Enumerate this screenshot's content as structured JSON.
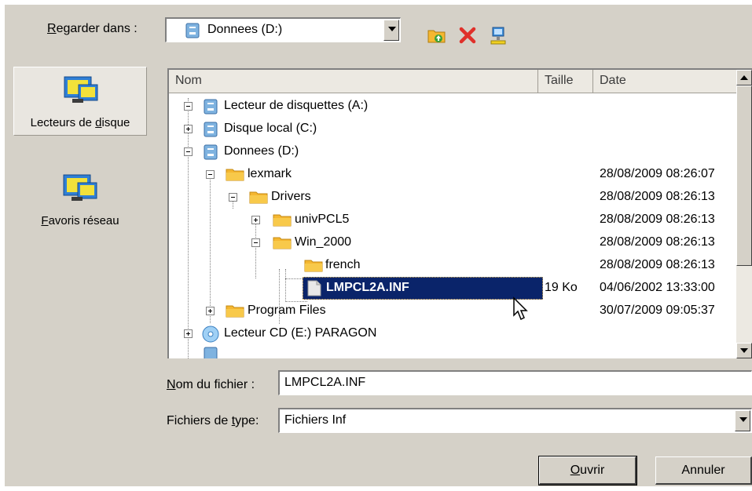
{
  "lookin": {
    "label_prefix": "",
    "label_ul": "R",
    "label_rest": "egarder dans :",
    "value": "Donnees (D:)"
  },
  "toolbar": {
    "icons": [
      "folder-up-icon",
      "delete-icon",
      "network-icon"
    ]
  },
  "places": [
    {
      "label_pre": "Lecteurs de ",
      "label_ul": "d",
      "label_post": "isque",
      "icon": "computer-icon",
      "selected": true
    },
    {
      "label_pre": "",
      "label_ul": "F",
      "label_post": "avoris réseau",
      "icon": "network-icon",
      "selected": false
    }
  ],
  "columns": {
    "name": "Nom",
    "size": "Taille",
    "date": "Date"
  },
  "tree": [
    {
      "name": "Lecteur de disquettes (A:)",
      "size": "",
      "date": "",
      "icon": "floppy-drive-icon"
    },
    {
      "name": "Disque local (C:)",
      "size": "",
      "date": "",
      "icon": "hard-drive-icon"
    },
    {
      "name": "Donnees (D:)",
      "size": "",
      "date": "",
      "icon": "hard-drive-icon"
    },
    {
      "name": "lexmark",
      "size": "",
      "date": "28/08/2009 08:26:07",
      "icon": "folder-icon"
    },
    {
      "name": "Drivers",
      "size": "",
      "date": "28/08/2009 08:26:13",
      "icon": "folder-icon"
    },
    {
      "name": "univPCL5",
      "size": "",
      "date": "28/08/2009 08:26:13",
      "icon": "folder-icon"
    },
    {
      "name": "Win_2000",
      "size": "",
      "date": "28/08/2009 08:26:13",
      "icon": "folder-icon"
    },
    {
      "name": "french",
      "size": "",
      "date": "28/08/2009 08:26:13",
      "icon": "folder-icon"
    },
    {
      "name": "LMPCL2A.INF",
      "size": "19 Ko",
      "date": "04/06/2002 13:33:00",
      "icon": "file-icon"
    },
    {
      "name": "Program Files",
      "size": "",
      "date": "30/07/2009 09:05:37",
      "icon": "folder-icon"
    },
    {
      "name": "Lecteur CD (E:) PARAGON",
      "size": "",
      "date": "",
      "icon": "cd-drive-icon"
    }
  ],
  "filename": {
    "label_ul": "N",
    "label_rest": "om du fichier :",
    "value": "LMPCL2A.INF"
  },
  "filetype": {
    "label_pre": "Fichiers de ",
    "label_ul": "t",
    "label_post": "ype:",
    "value": "Fichiers Inf"
  },
  "buttons": {
    "open_ul": "O",
    "open_rest": "uvrir",
    "cancel": "Annuler"
  },
  "colors": {
    "dialog_bg": "#d5d1c8",
    "selection": "#0a246a",
    "folder": "#f5b731"
  }
}
